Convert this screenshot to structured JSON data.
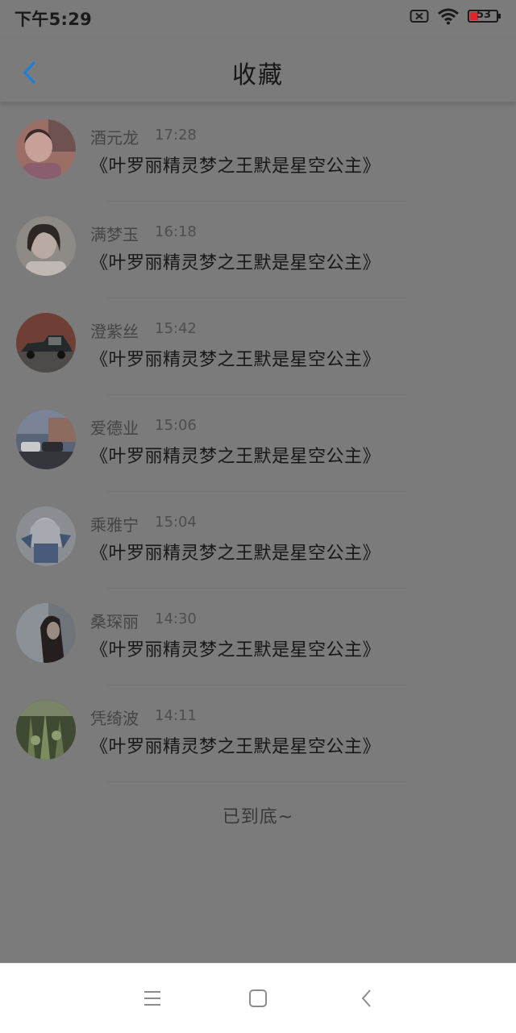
{
  "status_bar": {
    "time": "下午5:29",
    "battery_level": "53"
  },
  "header": {
    "title": "收藏"
  },
  "items": [
    {
      "name": "酒元龙",
      "time": "17:28",
      "text": "《叶罗丽精灵梦之王默是星空公主》"
    },
    {
      "name": "满梦玉",
      "time": "16:18",
      "text": "《叶罗丽精灵梦之王默是星空公主》"
    },
    {
      "name": "澄紫丝",
      "time": "15:42",
      "text": "《叶罗丽精灵梦之王默是星空公主》"
    },
    {
      "name": "爱德业",
      "time": "15:06",
      "text": "《叶罗丽精灵梦之王默是星空公主》"
    },
    {
      "name": "乘雅宁",
      "time": "15:04",
      "text": "《叶罗丽精灵梦之王默是星空公主》"
    },
    {
      "name": "桑琛丽",
      "time": "14:30",
      "text": "《叶罗丽精灵梦之王默是星空公主》"
    },
    {
      "name": "凭绮波",
      "time": "14:11",
      "text": "《叶罗丽精灵梦之王默是星空公主》"
    }
  ],
  "footer": {
    "end_text": "已到底~"
  },
  "nav_bar": {
    "icons": [
      "menu-icon",
      "home-icon",
      "back-icon"
    ]
  },
  "colors": {
    "accent": "#1f7fd6",
    "overlay": "#7b7b7b",
    "battery": "#e0242a"
  }
}
